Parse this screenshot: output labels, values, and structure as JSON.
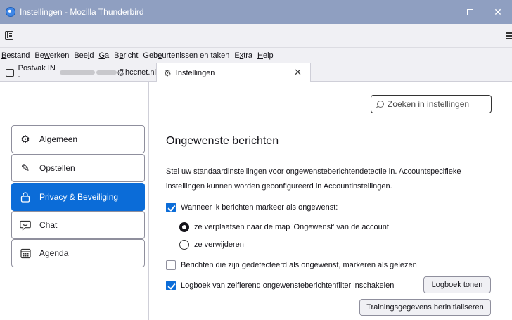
{
  "window": {
    "title": "Instellingen - Mozilla Thunderbird"
  },
  "menubar": [
    "Bestand",
    "Bewerken",
    "Beeld",
    "Ga",
    "Bericht",
    "Gebeurtenissen en taken",
    "Extra",
    "Help"
  ],
  "tabs": {
    "inbox": {
      "prefix": "Postvak IN - ",
      "suffix": "@hccnet.nl"
    },
    "settings": {
      "label": "Instellingen"
    }
  },
  "sidebar": {
    "items": [
      {
        "label": "Algemeen",
        "icon": "gear-icon"
      },
      {
        "label": "Opstellen",
        "icon": "pencil-icon"
      },
      {
        "label": "Privacy & Beveiliging",
        "icon": "lock-icon"
      },
      {
        "label": "Chat",
        "icon": "chat-bubble-icon"
      },
      {
        "label": "Agenda",
        "icon": "calendar-icon"
      }
    ],
    "active_index": 2
  },
  "search": {
    "placeholder": "Zoeken in instellingen"
  },
  "section": {
    "title": "Ongewenste berichten",
    "description": "Stel uw standaardinstellingen voor ongewensteberichtendetectie in. Accountspecifieke instellingen kunnen worden geconfigureerd in Accountinstellingen.",
    "mark_junk": {
      "label": "Wanneer ik berichten markeer als ongewenst:",
      "checked": true
    },
    "move_option": {
      "label": "ze verplaatsen naar de map 'Ongewenst' van de account",
      "selected": true
    },
    "delete_option": {
      "label": "ze verwijderen",
      "selected": false
    },
    "mark_read": {
      "label": "Berichten die zijn gedetecteerd als ongewenst, markeren als gelezen",
      "checked": false
    },
    "logging": {
      "label": "Logboek van zelflerend ongewensteberichtenfilter inschakelen",
      "checked": true
    },
    "show_log_button": "Logboek tonen",
    "reset_training_button": "Trainingsgegevens herinitialiseren"
  },
  "colors": {
    "accent": "#0b6cd8",
    "titlebar": "#8f9fc1"
  }
}
